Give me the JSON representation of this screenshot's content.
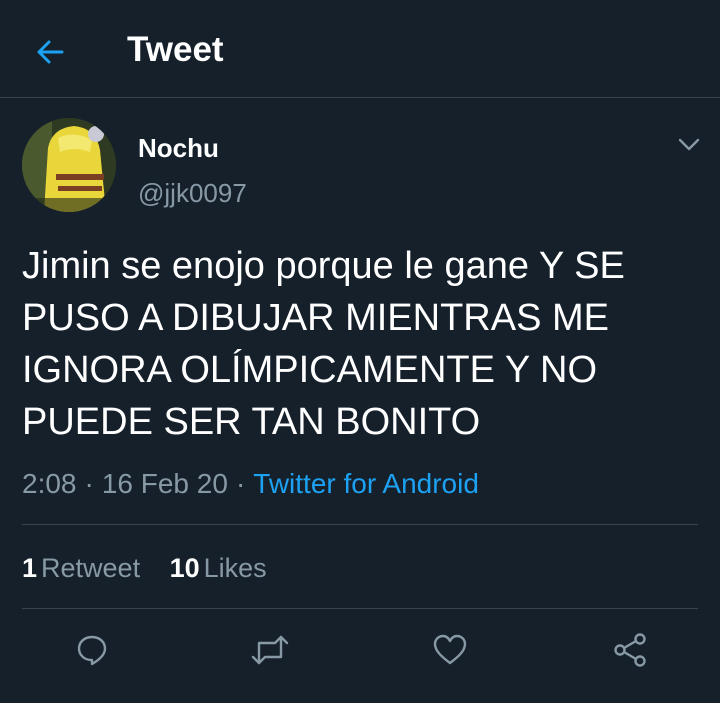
{
  "header": {
    "title": "Tweet",
    "back_icon": "arrow-left-icon"
  },
  "tweet": {
    "author": {
      "name": "Nochu",
      "handle": "@jjk0097"
    },
    "text": "Jimin se enojo porque le gane Y SE PUSO A DIBUJAR MIENTRAS ME IGNORA OLÍMPICAMENTE Y NO PUEDE SER TAN BONITO",
    "time": "2:08",
    "date": "16 Feb 20",
    "separator": "·",
    "source": "Twitter for Android"
  },
  "stats": {
    "retweets_count": "1",
    "retweets_label": "Retweet",
    "likes_count": "10",
    "likes_label": "Likes"
  },
  "actions": [
    "reply-icon",
    "retweet-icon",
    "like-icon",
    "share-icon"
  ],
  "colors": {
    "background": "#15202b",
    "accent": "#1da1f2",
    "secondary_text": "#8899a6",
    "divider": "#38444d"
  }
}
